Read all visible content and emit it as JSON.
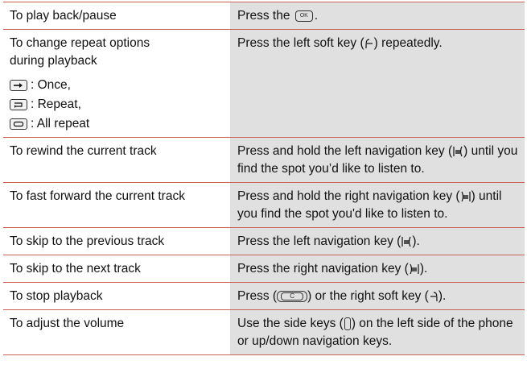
{
  "rows": [
    {
      "action": "To play back/pause",
      "desc_pre": "Press the",
      "desc_post": "."
    },
    {
      "action": "To change repeat options during playback",
      "options": [
        {
          "icon": "once-icon",
          "label": ": Once,"
        },
        {
          "icon": "repeat-icon",
          "label": ": Repeat,"
        },
        {
          "icon": "all-repeat-icon",
          "label": ": All repeat"
        }
      ],
      "desc_pre": "Press the left soft key (",
      "desc_post": ") repeatedly."
    },
    {
      "action": "To rewind the current track",
      "desc_pre": "Press and hold the left navigation key (",
      "desc_post": ") until you find the spot you’d like to listen to."
    },
    {
      "action": "To fast forward the current track",
      "desc_pre": "Press and hold the right navigation key (",
      "desc_post": ") until you find the spot you'd like to listen to."
    },
    {
      "action": "To skip to the previous track",
      "desc_pre": "Press the left navigation key (",
      "desc_post": ")."
    },
    {
      "action": "To skip to the next track",
      "desc_pre": "Press the right navigation key (",
      "desc_post": ")."
    },
    {
      "action": "To stop playback",
      "desc_pre": "Press (",
      "desc_mid": ") or the right soft key (",
      "desc_post": ")."
    },
    {
      "action": "To adjust the volume",
      "desc_pre": "Use the side keys (",
      "desc_post": ") on the left side of the phone or up/down navigation keys."
    }
  ],
  "keys": {
    "ok": "OK",
    "clear": "C"
  },
  "colors": {
    "rule": "#c9625a",
    "desc_bg": "#e0e0e0"
  }
}
